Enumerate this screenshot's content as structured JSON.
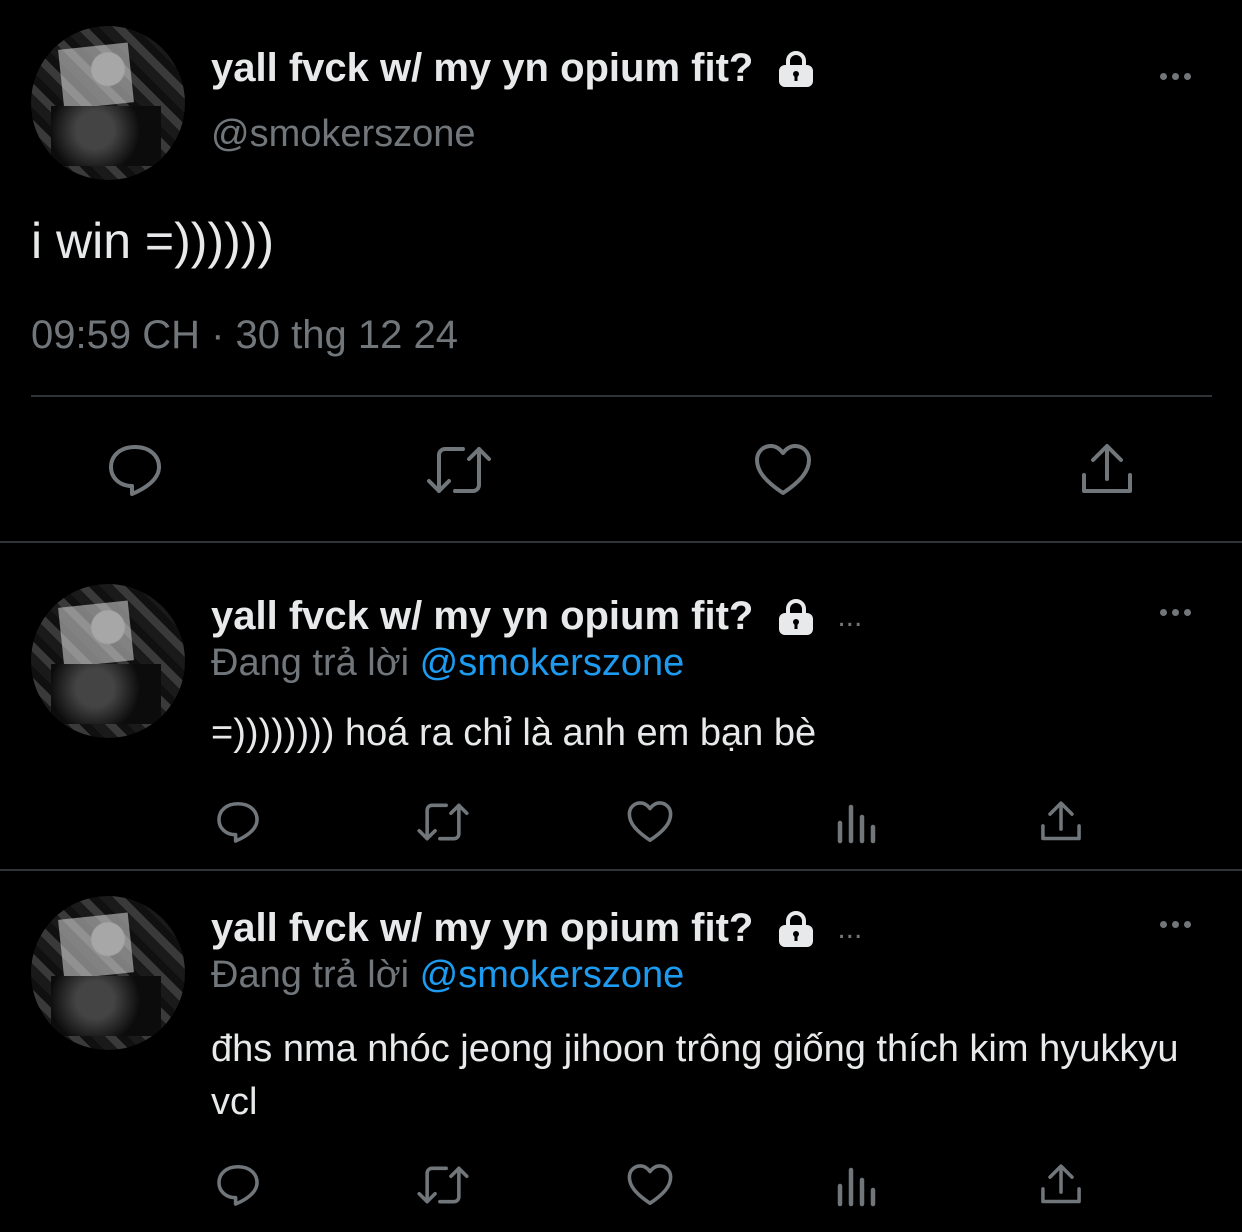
{
  "main_tweet": {
    "display_name": "yall fvck w/ my yn opium fit?",
    "handle": "@smokerszone",
    "text": "i win =))))))",
    "timestamp": "09:59 CH · 30 thg 12 24"
  },
  "replies": [
    {
      "display_name": "yall fvck w/ my yn opium fit?",
      "truncation": "...",
      "replying_prefix": "Đang trả lời",
      "replying_to": "@smokerszone",
      "text": "=)))))))) hoá ra chỉ là anh em bạn bè"
    },
    {
      "display_name": "yall fvck w/ my yn opium fit?",
      "truncation": "...",
      "replying_prefix": "Đang trả lời",
      "replying_to": "@smokerszone",
      "text": "đhs nma nhóc jeong jihoon trông giống thích kim hyukkyu vcl"
    }
  ],
  "icons": {
    "reply": "speech-bubble-icon",
    "retweet": "retweet-arrows-icon",
    "like": "heart-outline-icon",
    "views": "bar-chart-icon",
    "share": "share-upload-icon",
    "more": "three-dots-icon",
    "protected": "lock-icon"
  },
  "colors": {
    "background": "#000000",
    "text": "#e7e9ea",
    "muted": "#71767b",
    "link": "#1d9bf0",
    "divider": "#2f3336"
  }
}
